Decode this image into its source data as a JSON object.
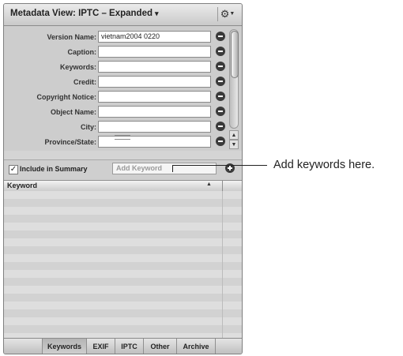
{
  "header": {
    "title": "Metadata View: IPTC – Expanded",
    "menu_caret": "▾",
    "action_icon": "gear-icon"
  },
  "fields": [
    {
      "label": "Version Name:",
      "value": "vietnam2004 0220"
    },
    {
      "label": "Caption:",
      "value": ""
    },
    {
      "label": "Keywords:",
      "value": ""
    },
    {
      "label": "Credit:",
      "value": ""
    },
    {
      "label": "Copyright Notice:",
      "value": ""
    },
    {
      "label": "Object Name:",
      "value": ""
    },
    {
      "label": "City:",
      "value": ""
    },
    {
      "label": "Province/State:",
      "value": ""
    }
  ],
  "summary": {
    "checkbox_checked": true,
    "checkbox_label": "Include in Summary",
    "keyword_placeholder": "Add Keyword"
  },
  "keyword_table": {
    "column_header": "Keyword",
    "rows": []
  },
  "tabs": [
    "Keywords",
    "EXIF",
    "IPTC",
    "Other",
    "Archive"
  ],
  "active_tab": "Keywords",
  "callout": {
    "text": "Add keywords here."
  }
}
